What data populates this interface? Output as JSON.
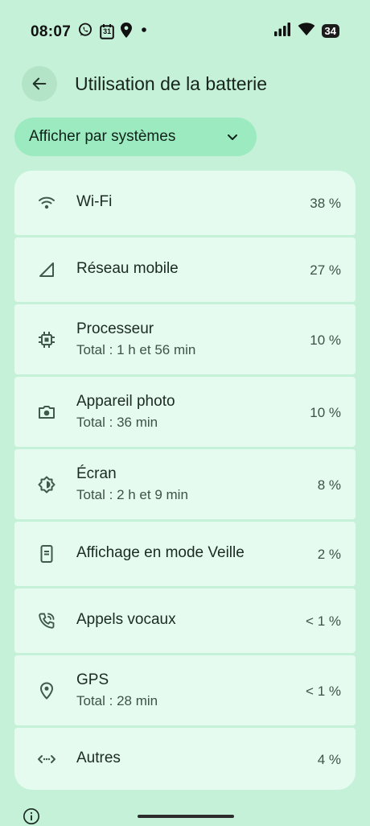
{
  "status_bar": {
    "time": "08:07",
    "calendar_day": "31",
    "battery_level": "34",
    "icons": [
      "whatsapp-icon",
      "calendar-icon",
      "location-icon",
      "dot-icon",
      "signal-icon",
      "wifi-icon",
      "battery-icon"
    ]
  },
  "header": {
    "title": "Utilisation de la batterie",
    "back_icon": "arrow-left-icon"
  },
  "filter": {
    "label": "Afficher par systèmes",
    "icon": "chevron-down-icon"
  },
  "items": [
    {
      "label": "Wi-Fi",
      "subtitle": "",
      "percent": "38 %",
      "icon": "wifi-icon"
    },
    {
      "label": "Réseau mobile",
      "subtitle": "",
      "percent": "27 %",
      "icon": "mobile-signal-icon"
    },
    {
      "label": "Processeur",
      "subtitle": "Total : 1 h et 56 min",
      "percent": "10 %",
      "icon": "cpu-icon"
    },
    {
      "label": "Appareil photo",
      "subtitle": "Total : 36 min",
      "percent": "10 %",
      "icon": "camera-icon"
    },
    {
      "label": "Écran",
      "subtitle": "Total : 2 h et 9 min",
      "percent": "8 %",
      "icon": "brightness-icon"
    },
    {
      "label": "Affichage en mode Veille",
      "subtitle": "",
      "percent": "2 %",
      "icon": "ambient-display-icon"
    },
    {
      "label": "Appels vocaux",
      "subtitle": "",
      "percent": "< 1 %",
      "icon": "phone-call-icon"
    },
    {
      "label": "GPS",
      "subtitle": "Total : 28 min",
      "percent": "< 1 %",
      "icon": "location-icon"
    },
    {
      "label": "Autres",
      "subtitle": "",
      "percent": "4 %",
      "icon": "code-arrows-icon"
    }
  ],
  "footer": {
    "info_icon": "info-icon"
  },
  "colors": {
    "background": "#c6f1d9",
    "card": "#e5fbf0",
    "chip": "#9beac0",
    "back_button": "#b4e4c7",
    "icon": "#3f5a4b"
  }
}
